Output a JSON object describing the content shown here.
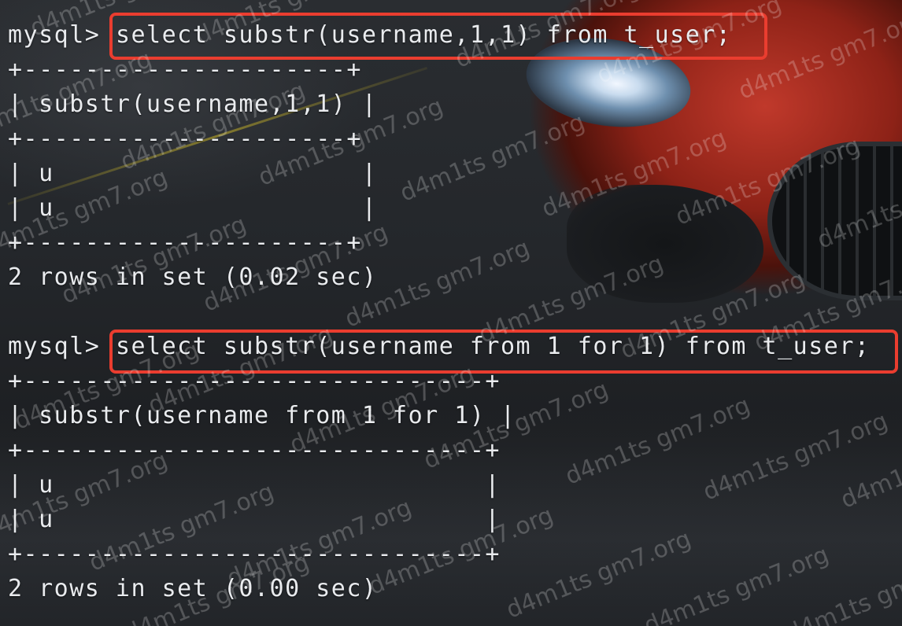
{
  "terminal": {
    "prompt": "mysql>",
    "queries": [
      {
        "command": "select substr(username,1,1) from t_user;",
        "table": {
          "border": "+---------------------+",
          "header": "| substr(username,1,1) |",
          "rows": [
            "| u                    |",
            "| u                    |"
          ]
        },
        "footer": "2 rows in set (0.02 sec)"
      },
      {
        "command": "select substr(username from 1 for 1) from t_user;",
        "table": {
          "border": "+------------------------------+",
          "header": "| substr(username from 1 for 1) |",
          "rows": [
            "| u                            |",
            "| u                            |"
          ]
        },
        "footer": "2 rows in set (0.00 sec)"
      }
    ]
  },
  "watermark": {
    "text": "d4m1ts gm7.org"
  },
  "colors": {
    "highlight": "#ea3d2f",
    "text": "#e9ebee"
  }
}
